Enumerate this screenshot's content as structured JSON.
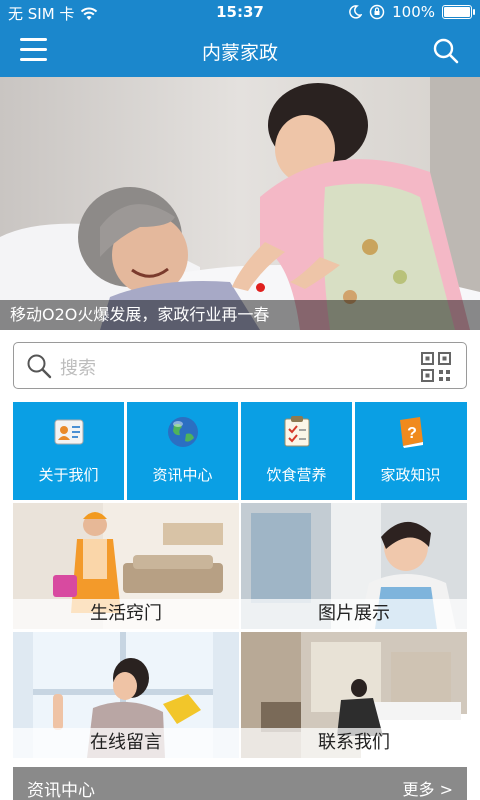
{
  "status_bar": {
    "carrier": "无 SIM 卡",
    "time": "15:37",
    "battery": "100%",
    "battery_level": 1.0
  },
  "navbar": {
    "title": "内蒙家政",
    "menu_icon": "hamburger-menu-icon",
    "search_icon": "search-icon"
  },
  "banner": {
    "caption": "移动O2O火爆发展，家政行业再一春",
    "active_slide": 1,
    "indicator_color": "#e0201e"
  },
  "search": {
    "placeholder": "搜索"
  },
  "tiles": [
    {
      "label": "关于我们",
      "icon": "contact-card-icon"
    },
    {
      "label": "资讯中心",
      "icon": "globe-icon"
    },
    {
      "label": "饮食营养",
      "icon": "checklist-icon"
    },
    {
      "label": "家政知识",
      "icon": "help-book-icon"
    }
  ],
  "grid": [
    {
      "label": "生活窍门"
    },
    {
      "label": "图片展示"
    },
    {
      "label": "在线留言"
    },
    {
      "label": "联系我们"
    }
  ],
  "news": {
    "title": "资讯中心",
    "more": "更多 >"
  },
  "colors": {
    "primary": "#1b87cc",
    "tile": "#0a9fe4",
    "section_bar": "#8a8a8a"
  }
}
